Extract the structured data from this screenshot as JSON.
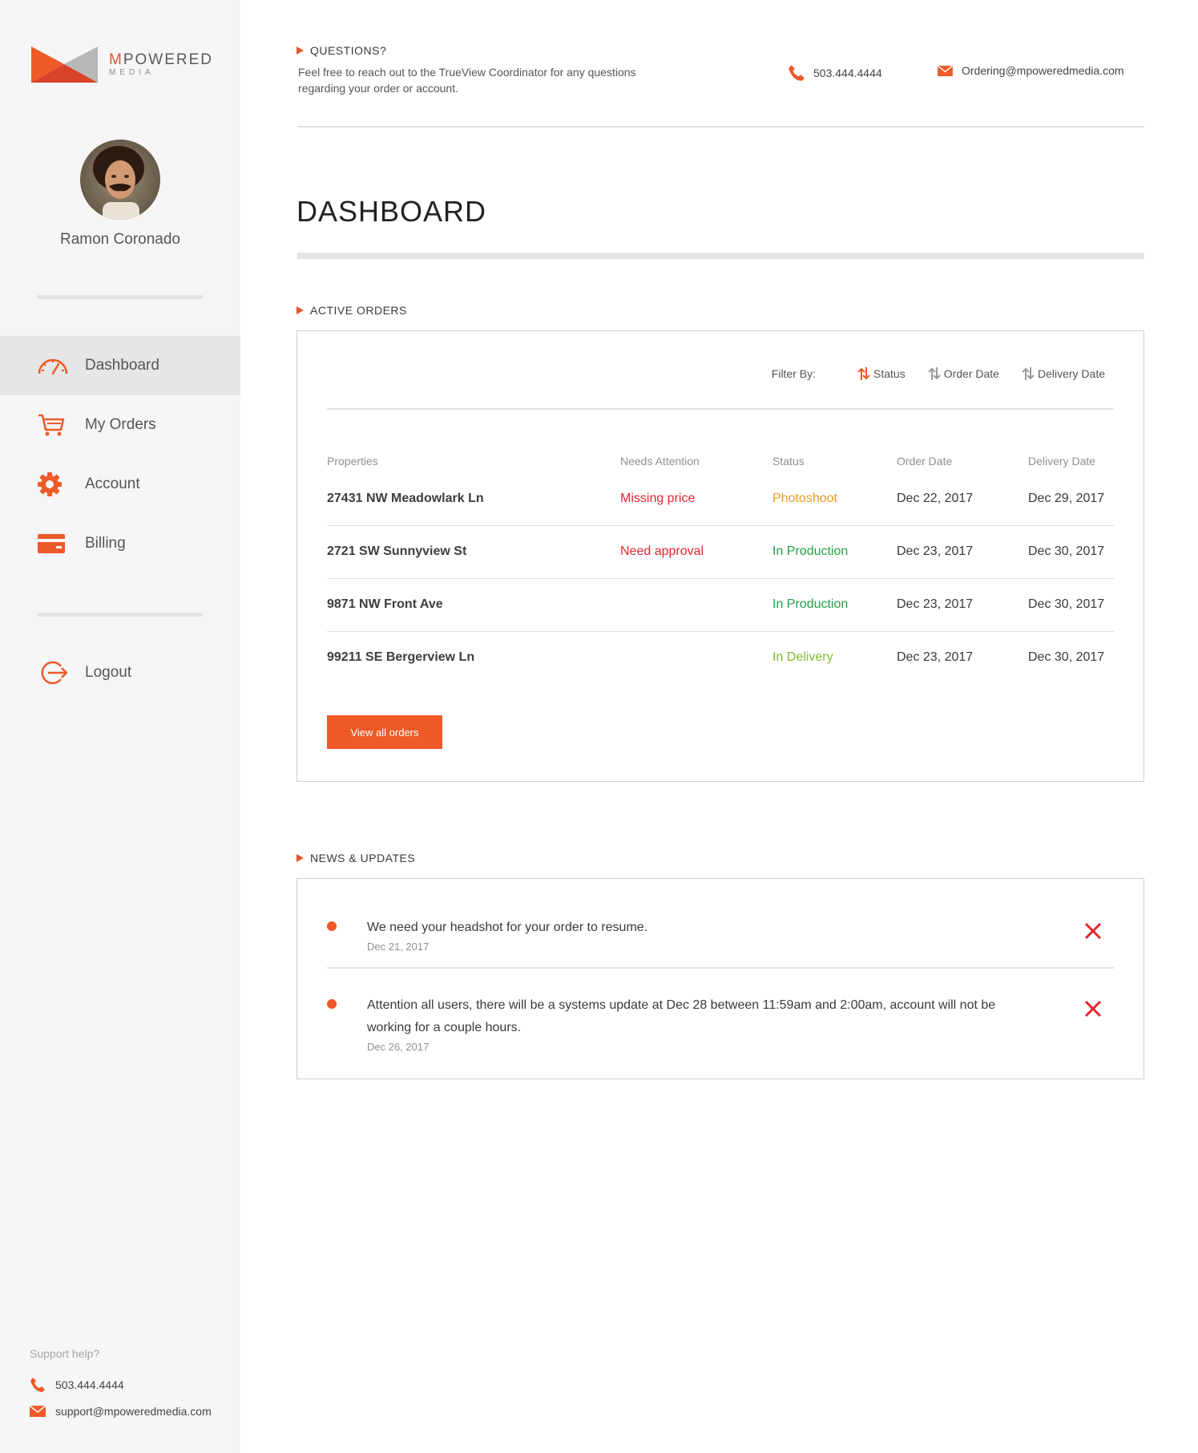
{
  "brand": {
    "name_first": "M",
    "name_rest": "POWERED",
    "sub": "MEDIA"
  },
  "user": {
    "name": "Ramon Coronado"
  },
  "nav": {
    "items": [
      {
        "label": "Dashboard",
        "icon": "speedometer-icon",
        "active": true
      },
      {
        "label": "My Orders",
        "icon": "cart-icon",
        "active": false
      },
      {
        "label": "Account",
        "icon": "gear-icon",
        "active": false
      },
      {
        "label": "Billing",
        "icon": "credit-card-icon",
        "active": false
      }
    ],
    "logout": "Logout"
  },
  "support": {
    "title": "Support help?",
    "phone": "503.444.4444",
    "email": "support@mpoweredmedia.com"
  },
  "questions": {
    "title": "QUESTIONS?",
    "text": "Feel free to reach out to the TrueView Coordinator for any questions regarding your order or account.",
    "phone": "503.444.4444",
    "email": "Ordering@mpoweredmedia.com"
  },
  "page": {
    "title": "DASHBOARD"
  },
  "orders": {
    "title": "ACTIVE ORDERS",
    "filter_label": "Filter By:",
    "filters": [
      "Status",
      "Order Date",
      "Delivery Date"
    ],
    "columns": [
      "Properties",
      "Needs Attention",
      "Status",
      "Order Date",
      "Delivery Date"
    ],
    "rows": [
      {
        "property": "27431 NW Meadowlark Ln",
        "attention": "Missing price",
        "status": "Photoshoot",
        "order_date": "Dec 22, 2017",
        "delivery_date": "Dec 29, 2017"
      },
      {
        "property": "2721 SW Sunnyview St",
        "attention": "Need approval",
        "status": "In Production",
        "order_date": "Dec 23, 2017",
        "delivery_date": "Dec 30, 2017"
      },
      {
        "property": "9871 NW Front Ave",
        "attention": "",
        "status": "In Production",
        "order_date": "Dec 23, 2017",
        "delivery_date": "Dec 30, 2017"
      },
      {
        "property": "99211 SE Bergerview Ln",
        "attention": "",
        "status": "In Delivery",
        "order_date": "Dec 23, 2017",
        "delivery_date": "Dec 30, 2017"
      }
    ],
    "view_all": "View all orders"
  },
  "news": {
    "title": "NEWS & UPDATES",
    "items": [
      {
        "text": "We need your headshot for your order to resume.",
        "date": "Dec 21, 2017"
      },
      {
        "text": "Attention all users, there will be a systems update at Dec 28 between 11:59am and 2:00am, account will not be working for a couple hours.",
        "date": "Dec 26, 2017"
      }
    ]
  },
  "colors": {
    "accent": "#ef5a28",
    "attention_red": "#e2262e",
    "status_photoshoot": "#f09a28",
    "status_production": "#24a148",
    "status_delivery": "#7cbc2e"
  }
}
